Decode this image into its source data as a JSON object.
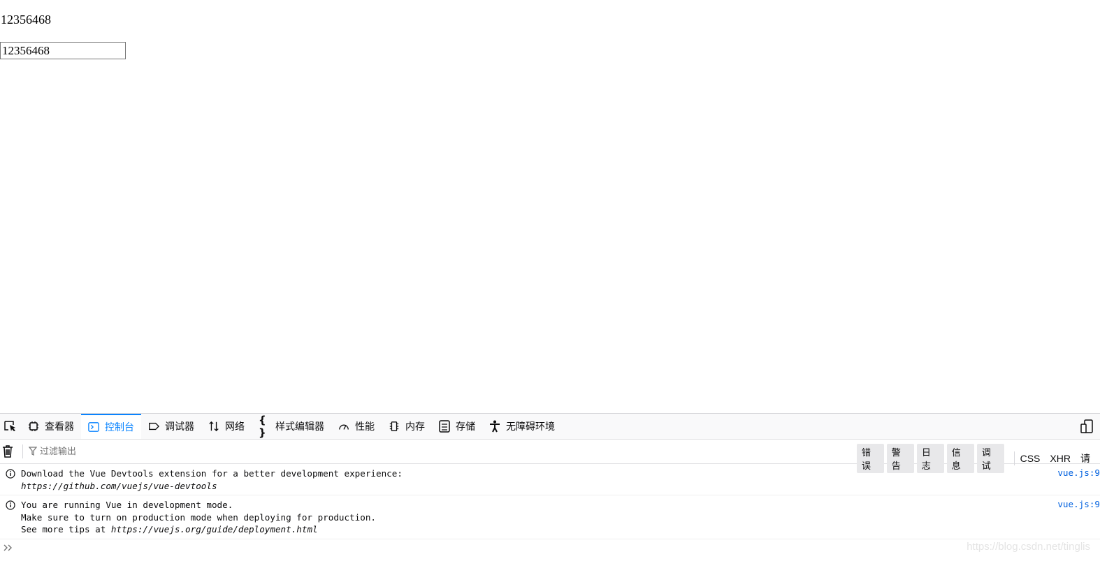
{
  "page": {
    "text": "12356468",
    "input_value": "12356468"
  },
  "devtools": {
    "tabs": [
      {
        "label": "查看器",
        "icon": "inspector-icon"
      },
      {
        "label": "控制台",
        "icon": "console-icon",
        "active": true
      },
      {
        "label": "调试器",
        "icon": "debugger-icon"
      },
      {
        "label": "网络",
        "icon": "network-icon"
      },
      {
        "label": "样式编辑器",
        "icon": "style-editor-icon"
      },
      {
        "label": "性能",
        "icon": "performance-icon"
      },
      {
        "label": "内存",
        "icon": "memory-icon"
      },
      {
        "label": "存储",
        "icon": "storage-icon"
      },
      {
        "label": "无障碍环境",
        "icon": "accessibility-icon"
      }
    ],
    "filter_placeholder": "过滤输出",
    "levels": [
      "错误",
      "警告",
      "日志",
      "信息",
      "调试"
    ],
    "categories": [
      "CSS",
      "XHR",
      "请"
    ],
    "messages": [
      {
        "line1": "Download the Vue Devtools extension for a better development experience:",
        "line2": "https://github.com/vuejs/vue-devtools",
        "location": "vue.js:9"
      },
      {
        "line1": "You are running Vue in development mode.",
        "line2": "Make sure to turn on production mode when deploying for production.",
        "line3_prefix": "See more tips at ",
        "line3_link": "https://vuejs.org/guide/deployment.html",
        "location": "vue.js:9"
      }
    ],
    "watermark": "https://blog.csdn.net/tinglis"
  }
}
